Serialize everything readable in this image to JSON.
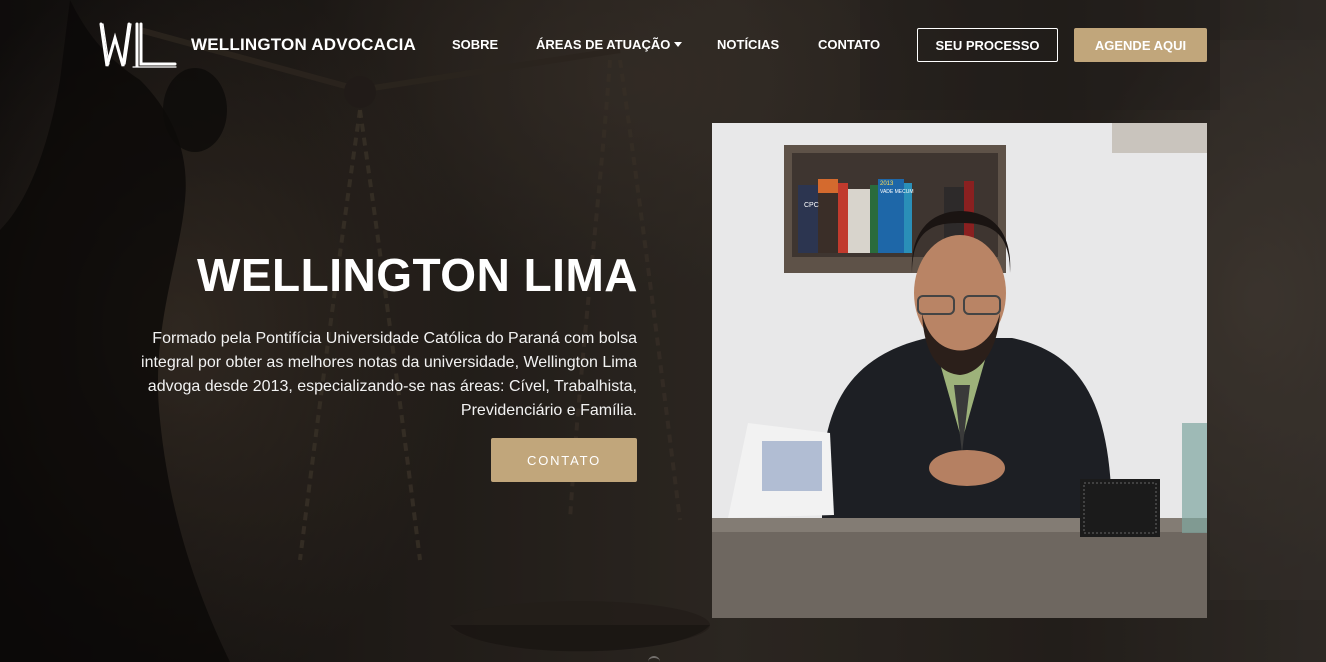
{
  "nav": {
    "brand": "WELLINGTON ADVOCACIA",
    "logo_text": "WL",
    "items": [
      {
        "label": "SOBRE"
      },
      {
        "label": "ÁREAS DE ATUAÇÃO",
        "has_dropdown": true
      },
      {
        "label": "NOTÍCIAS"
      },
      {
        "label": "CONTATO"
      }
    ],
    "outline_button": "SEU PROCESSO",
    "primary_button": "AGENDE AQUI"
  },
  "hero": {
    "title": "WELLINGTON LIMA",
    "description": "Formado pela Pontifícia Universidade Católica do Paraná com bolsa integral por obter as melhores notas da universidade, Wellington Lima advoga desde 2013, especializando-se nas áreas: Cível, Trabalhista, Previdenciário e Família.",
    "cta_label": "CONTATO"
  },
  "photo": {
    "book_labels": [
      "CPC",
      "VADE MECUM",
      "2013"
    ]
  },
  "colors": {
    "accent_gold": "#c1a67b",
    "text_white": "#ffffff",
    "background_dark": "#1b1714"
  },
  "icons": {
    "dropdown": "caret-down-icon",
    "background": "scales-of-justice-statue"
  }
}
